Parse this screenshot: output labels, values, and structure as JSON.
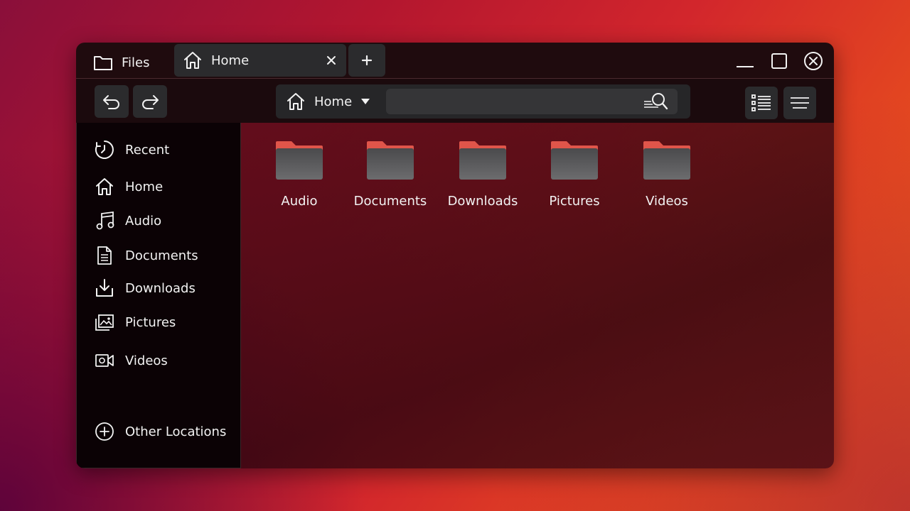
{
  "app": {
    "title": "Files"
  },
  "tabs": [
    {
      "label": "Home"
    }
  ],
  "toolbar": {
    "path_label": "Home",
    "search_placeholder": ""
  },
  "sidebar": {
    "items": [
      {
        "label": "Recent",
        "icon": "clock-icon"
      },
      {
        "label": "Home",
        "icon": "home-icon"
      },
      {
        "label": "Audio",
        "icon": "music-icon"
      },
      {
        "label": "Documents",
        "icon": "document-icon"
      },
      {
        "label": "Downloads",
        "icon": "download-icon"
      },
      {
        "label": "Pictures",
        "icon": "pictures-icon"
      },
      {
        "label": "Videos",
        "icon": "video-icon"
      }
    ],
    "other_locations": {
      "label": "Other Locations",
      "icon": "plus-circle-icon"
    }
  },
  "content": {
    "folders": [
      {
        "name": "Audio"
      },
      {
        "name": "Documents"
      },
      {
        "name": "Downloads"
      },
      {
        "name": "Pictures"
      },
      {
        "name": "Videos"
      }
    ]
  },
  "colors": {
    "folder_tab": "#e0554a",
    "folder_body": "#5c5c5e",
    "chrome": "#1f0b0e",
    "button": "#2b2b2d"
  }
}
